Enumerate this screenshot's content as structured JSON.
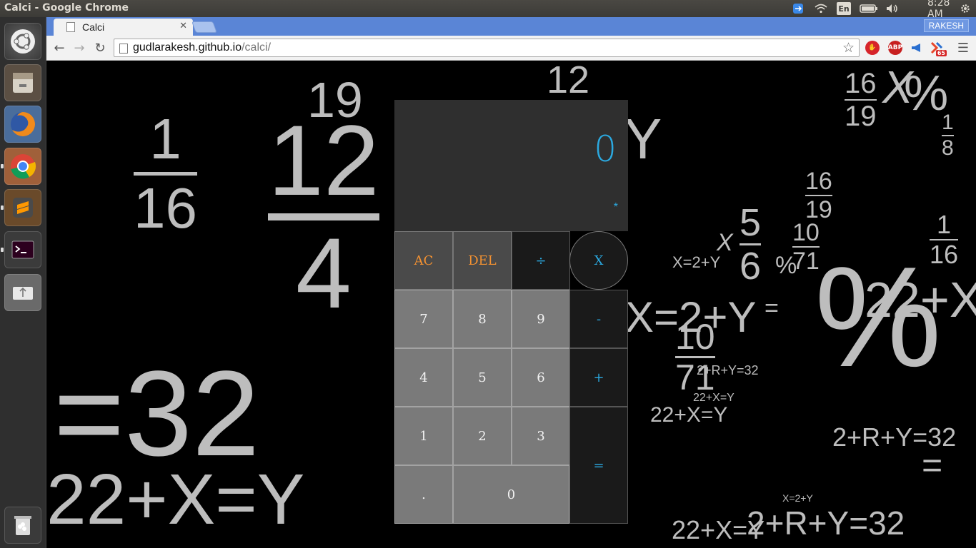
{
  "window": {
    "title": "Calci - Google Chrome"
  },
  "tray": {
    "keyboard": "En",
    "time": "8:28 AM"
  },
  "tab": {
    "title": "Calci"
  },
  "profile": {
    "name": "RAKESH"
  },
  "address": {
    "host": "gudlarakesh.github.io",
    "path": "/calci/"
  },
  "extensions": {
    "adblock": "ABP",
    "badge": "65"
  },
  "calculator": {
    "display": "0",
    "operator_indicator": "*",
    "keys": {
      "ac": "AC",
      "del": "DEL",
      "divide": "÷",
      "multiply": "X",
      "seven": "7",
      "eight": "8",
      "nine": "9",
      "minus": "-",
      "four": "4",
      "five": "5",
      "six": "6",
      "plus": "+",
      "one": "1",
      "two": "2",
      "three": "3",
      "equals": "=",
      "dot": ".",
      "zero": "0"
    }
  },
  "background": {
    "a": "=32",
    "b": "22+X=Y",
    "c": "X=2+Y",
    "d": "%",
    "e": "22+X=",
    "f": "X=2+Y",
    "g": "2+R+Y=32",
    "h": "22+X=Y",
    "i": "2+R+Y=32",
    "j": "X",
    "k": "Y",
    "l": "%",
    "m": "=",
    "n": "=",
    "frac1_num": "1",
    "frac1_den": "16",
    "frac2_num": "12",
    "frac2_den": "4",
    "frac3_num": "5",
    "frac3_den": "6",
    "frac4_num": "16",
    "frac4_den": "19",
    "frac5_num": "10",
    "frac5_den": "71",
    "frac6_num": "1",
    "frac6_den": "16",
    "frac7_num": "10",
    "frac7_den": "71",
    "frac8_num": "16",
    "frac8_den": "19",
    "frac9_num": "1",
    "frac9_den": "8",
    "top12": "12",
    "top19": "19",
    "pct2": "%",
    "x_small": "X",
    "mid_a": "22+X=Y",
    "mid_b": "22+X=Y",
    "mid_c": "2+R+Y=32",
    "mid_d": "X=2+Y"
  }
}
